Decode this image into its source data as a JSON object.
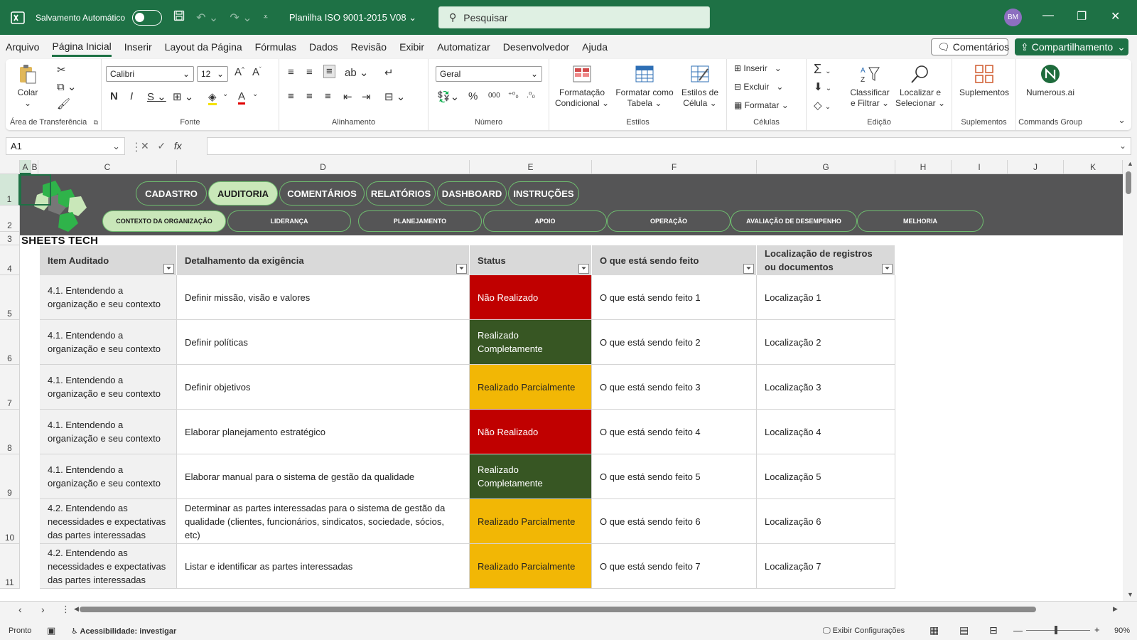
{
  "titlebar": {
    "autosave": "Salvamento Automático",
    "filename": "Planilha ISO 9001-2015 V08",
    "search_placeholder": "Pesquisar",
    "avatar": "BM"
  },
  "menu": [
    "Arquivo",
    "Página Inicial",
    "Inserir",
    "Layout da Página",
    "Fórmulas",
    "Dados",
    "Revisão",
    "Exibir",
    "Automatizar",
    "Desenvolvedor",
    "Ajuda"
  ],
  "menu_right": {
    "comments": "Comentários",
    "share": "Compartilhamento"
  },
  "ribbon": {
    "paste": "Colar",
    "clipboard": "Área de Transferência",
    "font_name": "Calibri",
    "font_size": "12",
    "font_group": "Fonte",
    "align_group": "Alinhamento",
    "number_format": "Geral",
    "number_group": "Número",
    "cond_format": "Formatação Condicional",
    "format_table": "Formatar como Tabela",
    "cell_styles": "Estilos de Célula",
    "styles_group": "Estilos",
    "insert": "Inserir",
    "delete": "Excluir",
    "format": "Formatar",
    "cells_group": "Células",
    "sort_filter": "Classificar e Filtrar",
    "find_select": "Localizar e Selecionar",
    "edit_group": "Edição",
    "addins": "Suplementos",
    "addins_group": "Suplementos",
    "numerous": "Numerous.ai",
    "commands_group": "Commands Group"
  },
  "namebox": "A1",
  "columns": [
    "A",
    "B",
    "C",
    "D",
    "E",
    "F",
    "G",
    "H",
    "I",
    "J",
    "K"
  ],
  "rows": [
    "1",
    "2",
    "3",
    "4",
    "5",
    "6",
    "7",
    "8",
    "9",
    "10",
    "11"
  ],
  "nav_tabs": [
    "CADASTRO",
    "AUDITORIA",
    "COMENTÁRIOS",
    "RELATÓRIOS",
    "DASHBOARD",
    "INSTRUÇÕES"
  ],
  "sub_tabs": [
    "CONTEXTO DA ORGANIZAÇÃO",
    "LIDERANÇA",
    "PLANEJAMENTO",
    "APOIO",
    "OPERAÇÃO",
    "AVALIAÇÃO DE DESEMPENHO",
    "MELHORIA"
  ],
  "brand": "SHEETS TECH",
  "table": {
    "headers": [
      "Item Auditado",
      "Detalhamento da exigência",
      "Status",
      "O que está sendo feito",
      "Localização de registros ou documentos"
    ],
    "rows": [
      [
        "4.1. Entendendo a organização e seu contexto",
        "Definir missão, visão e valores",
        "Não Realizado",
        "O que está sendo feito 1",
        "Localização 1"
      ],
      [
        "4.1. Entendendo a organização e seu contexto",
        "Definir políticas",
        "Realizado Completamente",
        "O que está sendo feito 2",
        "Localização 2"
      ],
      [
        "4.1. Entendendo a organização e seu contexto",
        "Definir objetivos",
        "Realizado Parcialmente",
        "O que está sendo feito 3",
        "Localização 3"
      ],
      [
        "4.1. Entendendo a organização e seu contexto",
        "Elaborar planejamento estratégico",
        "Não Realizado",
        "O que está sendo feito 4",
        "Localização 4"
      ],
      [
        "4.1. Entendendo a organização e seu contexto",
        "Elaborar manual para o sistema de gestão da qualidade",
        "Realizado Completamente",
        "O que está sendo feito 5",
        "Localização 5"
      ],
      [
        "4.2. Entendendo as necessidades e expectativas das partes interessadas",
        "Determinar as partes interessadas para o sistema de gestão da qualidade (clientes, funcionários, sindicatos, sociedade, sócios, etc)",
        "Realizado Parcialmente",
        "O que está sendo feito 6",
        "Localização 6"
      ],
      [
        "4.2. Entendendo as necessidades e expectativas das partes interessadas",
        "Listar e identificar as partes interessadas",
        "Realizado Parcialmente",
        "O que está sendo feito 7",
        "Localização 7"
      ]
    ]
  },
  "status": {
    "ready": "Pronto",
    "accessibility": "Acessibilidade: investigar",
    "display_settings": "Exibir Configurações",
    "zoom": "90%"
  },
  "colors": {
    "excel_green": "#1e7145",
    "not_done": "#c00000",
    "done": "#375623",
    "partial": "#f2b705",
    "banner": "#555556",
    "tab_active": "#c9e7b9"
  }
}
